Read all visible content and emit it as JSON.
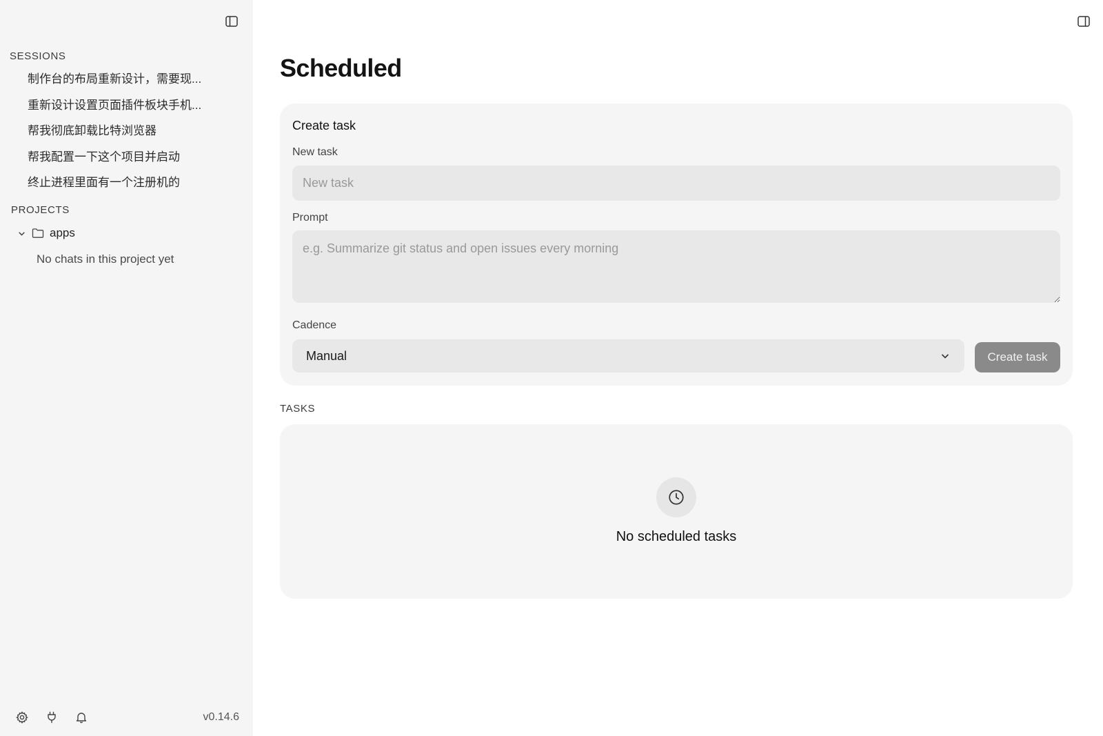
{
  "sidebar": {
    "sessions_heading": "SESSIONS",
    "sessions": [
      "制作台的布局重新设计，需要现...",
      "重新设计设置页面插件板块手机...",
      "帮我彻底卸载比特浏览器",
      "帮我配置一下这个项目并启动",
      "终止进程里面有一个注册机的"
    ],
    "projects_heading": "PROJECTS",
    "project": {
      "name": "apps",
      "empty_text": "No chats in this project yet"
    },
    "version": "v0.14.6"
  },
  "main": {
    "title": "Scheduled",
    "create_card": {
      "title": "Create task",
      "new_task_label": "New task",
      "new_task_placeholder": "New task",
      "prompt_label": "Prompt",
      "prompt_placeholder": "e.g. Summarize git status and open issues every morning",
      "cadence_label": "Cadence",
      "cadence_value": "Manual",
      "create_button": "Create task"
    },
    "tasks_heading": "TASKS",
    "tasks_empty": "No scheduled tasks"
  },
  "icons": {
    "sidebar_toggle": "sidebar-left-icon",
    "panel_toggle": "sidebar-right-icon",
    "settings": "gear-icon",
    "plugins": "plug-icon",
    "notifications": "bell-icon",
    "empty_state": "clock-icon"
  }
}
